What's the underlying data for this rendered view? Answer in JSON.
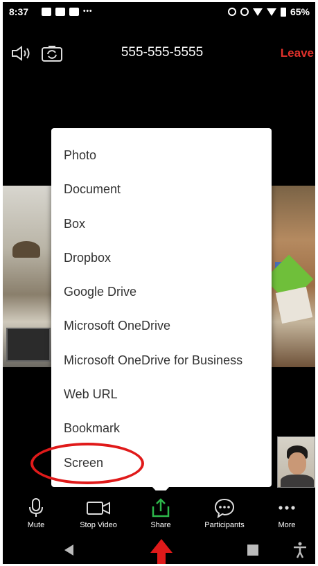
{
  "status_bar": {
    "time": "8:37",
    "battery_percent": "65%"
  },
  "top_bar": {
    "phone_number": "555-555-5555",
    "leave_label": "Leave",
    "leave_color": "#e0312b",
    "icons": [
      "speaker-icon",
      "camera-flip-icon"
    ]
  },
  "share_menu": {
    "items": [
      "Photo",
      "Document",
      "Box",
      "Dropbox",
      "Google Drive",
      "Microsoft OneDrive",
      "Microsoft OneDrive for Business",
      "Web URL",
      "Bookmark",
      "Screen"
    ],
    "highlighted_item": "Screen",
    "highlight_color": "#e01a1a"
  },
  "toolbar": {
    "items": [
      {
        "label": "Mute",
        "icon": "microphone-icon"
      },
      {
        "label": "Stop Video",
        "icon": "video-camera-icon"
      },
      {
        "label": "Share",
        "icon": "share-icon",
        "color": "#2db84b"
      },
      {
        "label": "Participants",
        "icon": "participants-icon"
      },
      {
        "label": "More",
        "icon": "more-icon"
      }
    ]
  },
  "nav_bar": {
    "icons": [
      "back-icon",
      "home-icon",
      "recent-apps-icon",
      "accessibility-icon"
    ]
  }
}
